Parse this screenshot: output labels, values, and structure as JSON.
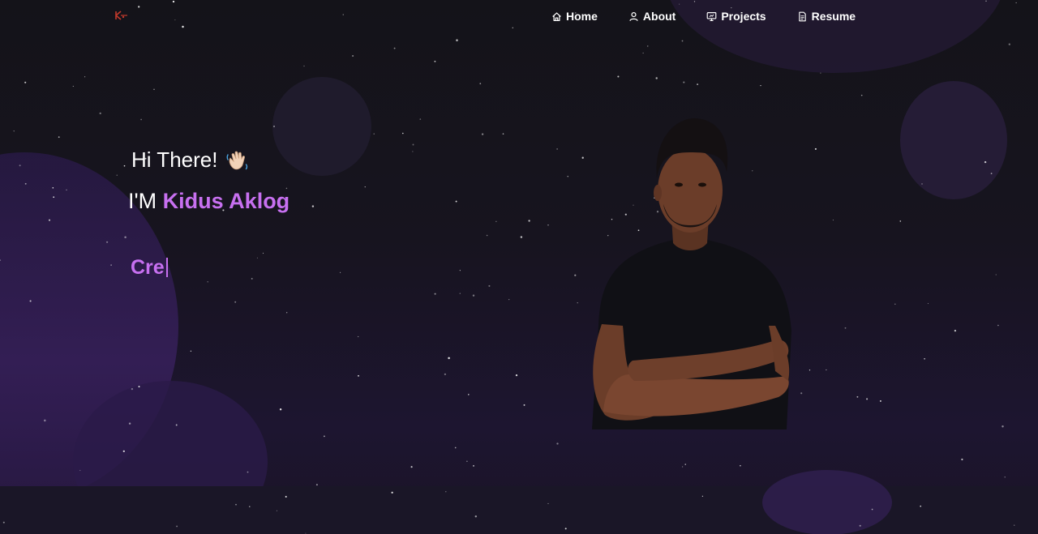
{
  "nav": {
    "logo_icon": "initials-logo-icon",
    "items": [
      {
        "label": "Home",
        "icon": "home-icon"
      },
      {
        "label": "About",
        "icon": "user-icon"
      },
      {
        "label": "Projects",
        "icon": "presentation-icon"
      },
      {
        "label": "Resume",
        "icon": "document-icon"
      }
    ]
  },
  "hero": {
    "greeting": "Hi There!",
    "greeting_icon": "waving-hand-icon",
    "intro_prefix": "I'M",
    "name": "Kidus Aklog",
    "typed_text": "Cre"
  },
  "colors": {
    "accent": "#c770f0",
    "background": "#141319",
    "text": "#ffffff"
  }
}
